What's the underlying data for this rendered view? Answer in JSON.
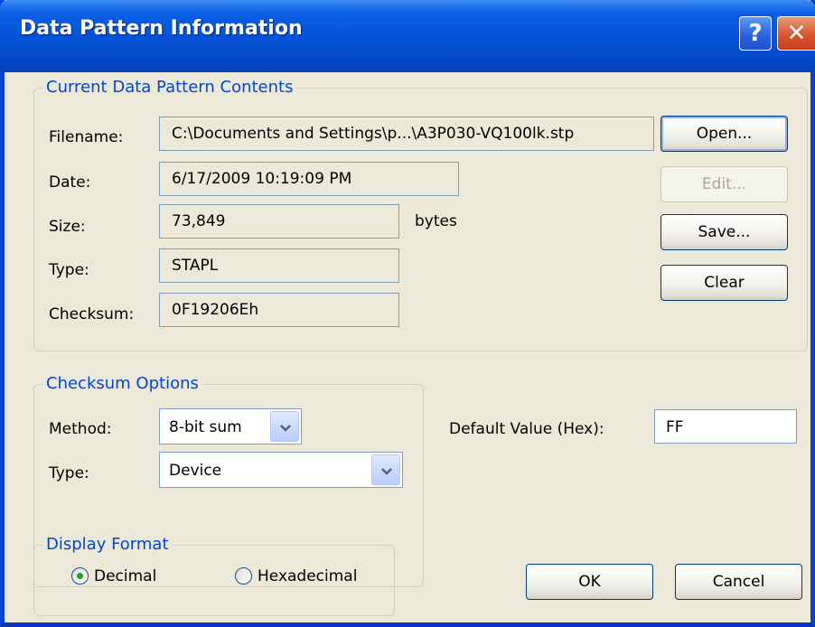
{
  "window": {
    "title": "Data Pattern Information",
    "help_label": "?",
    "close_label": "✕"
  },
  "current": {
    "legend": "Current Data Pattern Contents",
    "filename_label": "Filename:",
    "filename_value": "C:\\Documents and Settings\\p...\\A3P030-VQ100lk.stp",
    "date_label": "Date:",
    "date_value": "6/17/2009 10:19:09 PM",
    "size_label": "Size:",
    "size_value": "73,849",
    "size_unit": "bytes",
    "type_label": "Type:",
    "type_value": "STAPL",
    "checksum_label": "Checksum:",
    "checksum_value": "0F19206Eh"
  },
  "buttons": {
    "open": "Open...",
    "edit": "Edit...",
    "save": "Save...",
    "clear": "Clear",
    "ok": "OK",
    "cancel": "Cancel"
  },
  "checksum_options": {
    "legend": "Checksum Options",
    "method_label": "Method:",
    "method_value": "8-bit sum",
    "type_label": "Type:",
    "type_value": "Device"
  },
  "default_value": {
    "label": "Default Value (Hex):",
    "value": "FF"
  },
  "display_format": {
    "legend": "Display Format",
    "options": [
      "Decimal",
      "Hexadecimal"
    ],
    "selected": "Decimal"
  }
}
